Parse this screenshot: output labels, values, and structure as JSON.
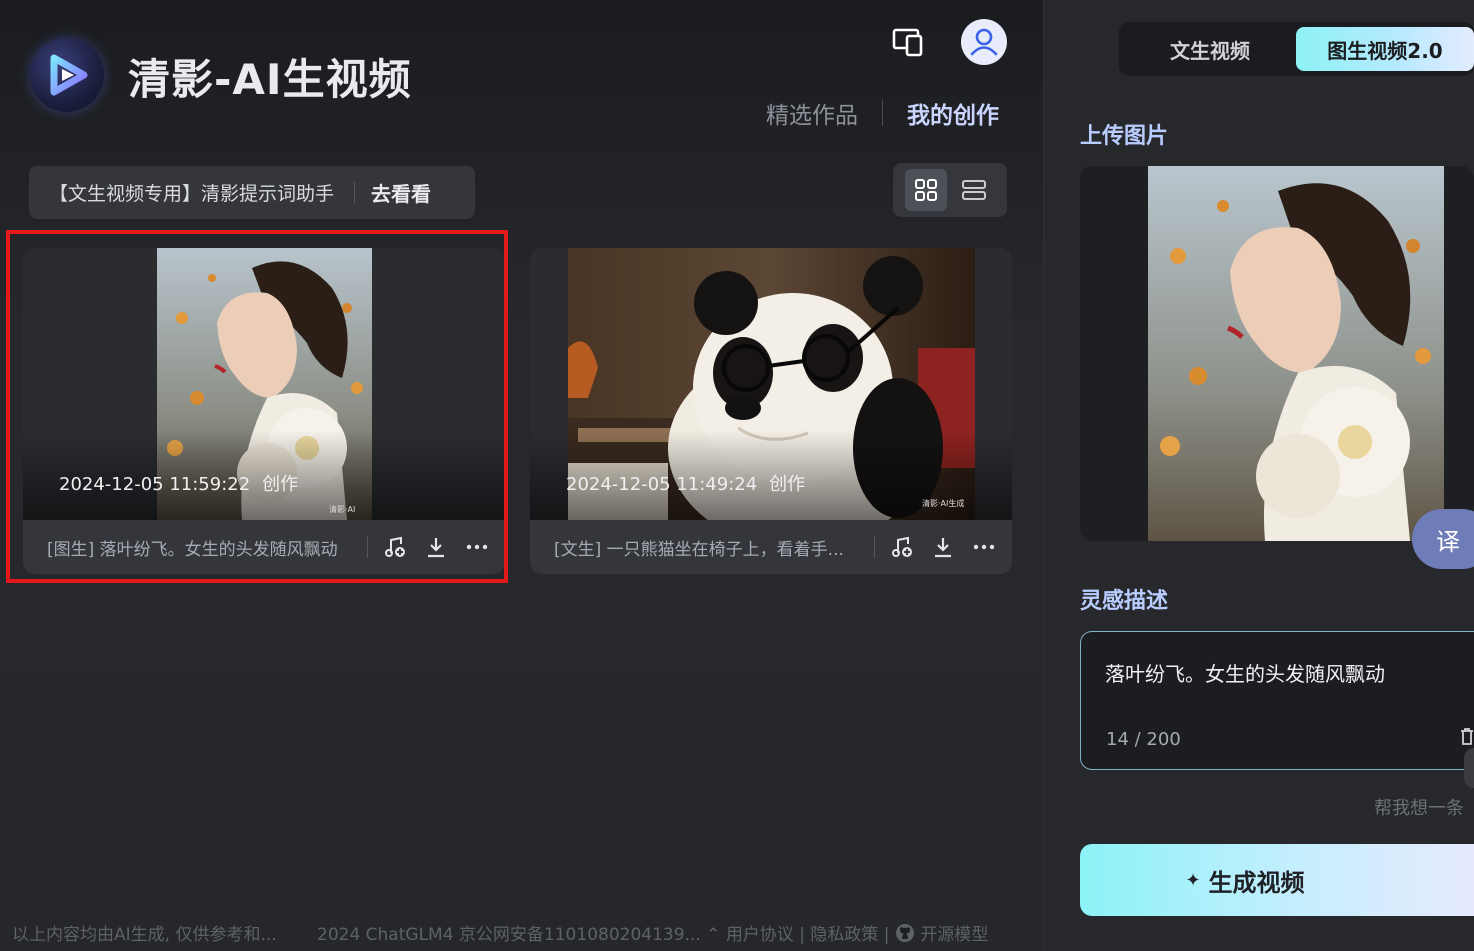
{
  "app": {
    "title": "清影-AI生视频"
  },
  "header": {
    "nav": [
      {
        "label": "精选作品",
        "active": false
      },
      {
        "label": "我的创作",
        "active": true
      }
    ],
    "icons": [
      "multi-device-icon",
      "user-avatar-icon"
    ]
  },
  "assistant_banner": {
    "text": "【文生视频专用】清影提示词助手",
    "action": "去看看"
  },
  "view_toggle": {
    "options": [
      "grid-view",
      "list-view"
    ],
    "selected": "grid-view"
  },
  "cards": [
    {
      "timestamp": "2024-12-05 11:59:22",
      "tag": "创作",
      "caption": "[图生] 落叶纷飞。女生的头发随风飘动",
      "watermark": "清影·AI",
      "highlighted": true
    },
    {
      "timestamp": "2024-12-05 11:49:24",
      "tag": "创作",
      "caption": "[文生] 一只熊猫坐在椅子上，看着手...",
      "watermark": "清影·AI生成",
      "highlighted": false
    }
  ],
  "footer": {
    "disclaimer": "以上内容均由AI生成, 仅供参考和...",
    "license": "2024 ChatGLM4 京公网安备1101080204139...",
    "links": [
      "用户协议",
      "隐私政策",
      "开源模型"
    ]
  },
  "panel": {
    "modes": [
      {
        "label": "文生视频",
        "selected": false
      },
      {
        "label": "图生视频2.0",
        "selected": true
      }
    ],
    "upload_label": "上传图片",
    "translate_label": "译",
    "desc_label": "灵感描述",
    "desc_text": "落叶纷飞。女生的头发随风飘动",
    "char_count": "14 / 200",
    "help_link": "帮我想一条",
    "generate_label": "生成视频"
  },
  "colors": {
    "accent": "#8df2f5",
    "highlight_box": "#e3191e",
    "active_tab": "#c9d4ff"
  }
}
